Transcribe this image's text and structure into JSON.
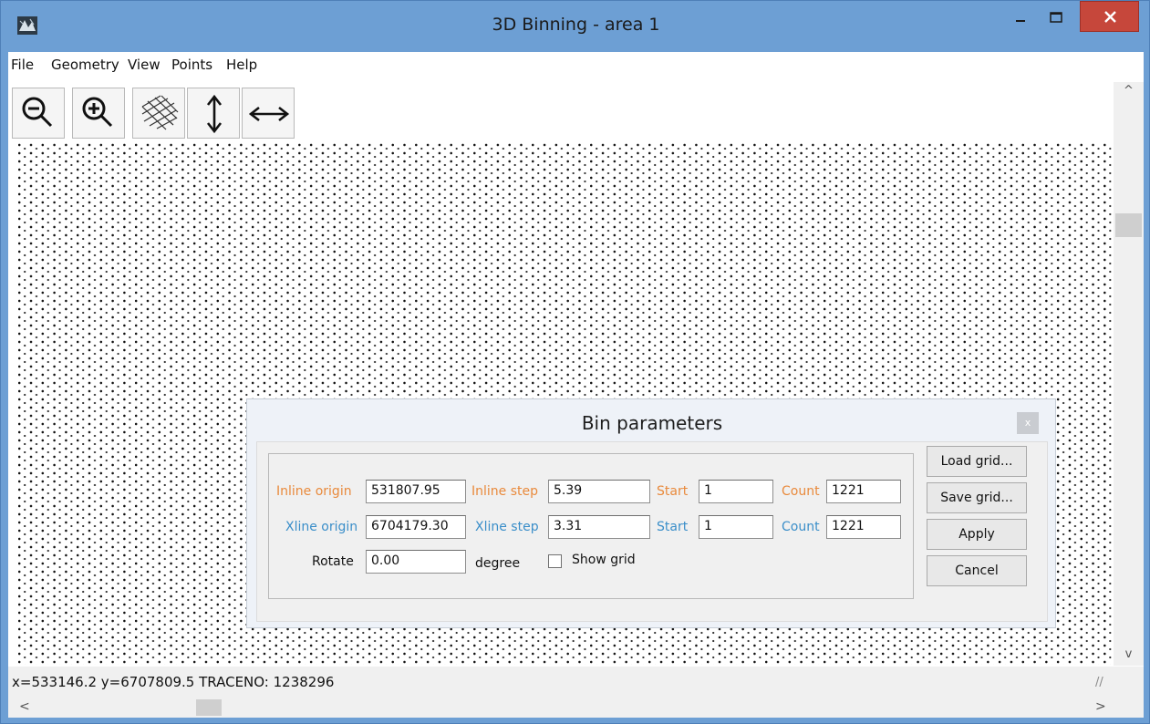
{
  "window": {
    "title": "3D Binning - area 1",
    "min_icon": "minimize-icon",
    "max_icon": "maximize-icon",
    "close_icon": "close-icon",
    "close_glyph": "×"
  },
  "menu": [
    "File",
    "Geometry",
    "View",
    "Points",
    "Help"
  ],
  "toolbar": {
    "buttons": [
      {
        "name": "zoom-out",
        "icon": "zoom-out-icon"
      },
      {
        "name": "zoom-in",
        "icon": "zoom-in-icon"
      },
      {
        "name": "grid",
        "icon": "grid-mesh-icon"
      },
      {
        "name": "stretch-vertical",
        "icon": "vertical-arrow-icon"
      },
      {
        "name": "stretch-horizontal",
        "icon": "horizontal-arrow-icon"
      }
    ]
  },
  "status": {
    "text": "x=533146.2 y=6707809.5 TRACENO: 1238296"
  },
  "scroll": {
    "up": "^",
    "down": "v",
    "left": "<",
    "right": ">"
  },
  "dialog": {
    "title": "Bin parameters",
    "close": "x",
    "inline": {
      "origin_label": "Inline origin",
      "origin_value": "531807.95",
      "step_label": "Inline step",
      "step_value": "5.39",
      "start_label": "Start",
      "start_value": "1",
      "count_label": "Count",
      "count_value": "1221"
    },
    "xline": {
      "origin_label": "Xline origin",
      "origin_value": "6704179.30",
      "step_label": "Xline step",
      "step_value": "3.31",
      "start_label": "Start",
      "start_value": "1",
      "count_label": "Count",
      "count_value": "1221"
    },
    "rotate": {
      "label": "Rotate",
      "value": "0.00",
      "unit": "degree"
    },
    "show_grid": {
      "label": "Show grid",
      "checked": false
    },
    "buttons": {
      "load": "Load grid...",
      "save": "Save grid...",
      "apply": "Apply",
      "cancel": "Cancel"
    },
    "colors": {
      "inline": "#e98a3c",
      "xline": "#3a8ec9"
    }
  }
}
